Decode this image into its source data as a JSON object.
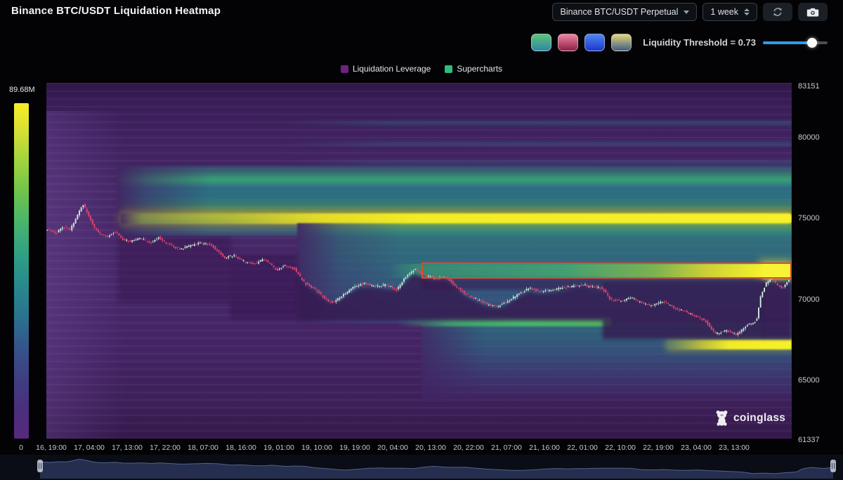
{
  "header": {
    "title": "Binance BTC/USDT Liquidation Heatmap",
    "pair_select": "Binance BTC/USDT Perpetual",
    "interval_select": "1 week"
  },
  "toolbar": {
    "threshold_label": "Liquidity Threshold = 0.73",
    "threshold_value": 0.73,
    "palettes": [
      {
        "name": "green-teal",
        "stops": [
          "#5cc573",
          "#2f86a8"
        ]
      },
      {
        "name": "pink-red",
        "stops": [
          "#ef86a4",
          "#8c1f44"
        ]
      },
      {
        "name": "blue",
        "stops": [
          "#4d86f2",
          "#1c38cc"
        ]
      },
      {
        "name": "yellow-steel",
        "stops": [
          "#e7d878",
          "#3e5c88"
        ]
      }
    ]
  },
  "legend": [
    {
      "label": "Liquidation Leverage",
      "color": "#6a2380"
    },
    {
      "label": "Supercharts",
      "color": "#2ebd7d"
    }
  ],
  "colorbar": {
    "max": "89.68M",
    "min": "0"
  },
  "watermark": "coinglass",
  "colors": {
    "accent_blue": "#2e9bf0",
    "annotation_red": "#e2492b",
    "candle_up": "#cfeede",
    "candle_down": "#e5446e",
    "heat_low": "#46266a",
    "heat_mid": "#21918c",
    "heat_high": "#f6ee21"
  },
  "chart_data": {
    "type": "heatmap",
    "subtype": "liquidation-heatmap-with-candlesticks",
    "y_axis": {
      "min": 61337,
      "max": 83151,
      "ticks": [
        83151,
        80000,
        75000,
        70000,
        65000,
        61337
      ]
    },
    "x_axis": {
      "ticks": [
        "16, 19:00",
        "17, 04:00",
        "17, 13:00",
        "17, 22:00",
        "18, 07:00",
        "18, 16:00",
        "19, 01:00",
        "19, 10:00",
        "19, 19:00",
        "20, 04:00",
        "20, 13:00",
        "20, 22:00",
        "21, 07:00",
        "21, 16:00",
        "22, 01:00",
        "22, 10:00",
        "22, 19:00",
        "23, 04:00",
        "23, 13:00"
      ]
    },
    "colorbar": {
      "max_label": "89.68M",
      "min_label": "0",
      "max_value_usd": 89680000
    },
    "liquidity_levels": [
      {
        "price": 75050,
        "extent": "full width",
        "intensity": 1.0
      },
      {
        "price": 77200,
        "extent": "from 17, 04:00",
        "intensity": 0.6
      },
      {
        "price": 71700,
        "extent": "from 20, 04:00 to end",
        "intensity": 0.9,
        "boxed": true
      },
      {
        "price": 68700,
        "extent": "19, 19:00 to 22, 10:00",
        "intensity": 0.6
      },
      {
        "price": 67300,
        "extent": "from 22, 10:00 to end",
        "intensity": 0.95
      }
    ],
    "annotation_box": {
      "t0": 0.503,
      "t1": 1.0,
      "price_top": 72260,
      "price_bottom": 71320,
      "color": "#e2492b"
    },
    "price_path": {
      "t": [
        0.005,
        0.014,
        0.024,
        0.033,
        0.04,
        0.05,
        0.057,
        0.065,
        0.073,
        0.085,
        0.094,
        0.104,
        0.113,
        0.127,
        0.141,
        0.151,
        0.165,
        0.179,
        0.193,
        0.207,
        0.221,
        0.231,
        0.24,
        0.254,
        0.268,
        0.282,
        0.292,
        0.301,
        0.311,
        0.32,
        0.334,
        0.348,
        0.362,
        0.377,
        0.386,
        0.4,
        0.414,
        0.428,
        0.443,
        0.457,
        0.471,
        0.485,
        0.496,
        0.508,
        0.523,
        0.537,
        0.551,
        0.565,
        0.579,
        0.593,
        0.607,
        0.621,
        0.636,
        0.65,
        0.664,
        0.678,
        0.692,
        0.706,
        0.72,
        0.734,
        0.747,
        0.758,
        0.772,
        0.786,
        0.8,
        0.814,
        0.829,
        0.843,
        0.857,
        0.871,
        0.885,
        0.899,
        0.913,
        0.927,
        0.941,
        0.954,
        0.96,
        0.967,
        0.974,
        0.982,
        0.989,
        0.997
      ],
      "price": [
        74300,
        74100,
        74500,
        74300,
        74900,
        75900,
        75300,
        74500,
        74000,
        73900,
        74200,
        73700,
        73600,
        73800,
        73500,
        73850,
        73400,
        73100,
        73300,
        73500,
        73400,
        73000,
        72600,
        72700,
        72300,
        72200,
        72500,
        72200,
        71800,
        72100,
        71900,
        71000,
        70600,
        70000,
        69800,
        70300,
        70800,
        71000,
        70800,
        70900,
        70600,
        71500,
        71900,
        71500,
        71300,
        71400,
        70800,
        70300,
        70000,
        69700,
        69600,
        69900,
        70400,
        70700,
        70500,
        70600,
        70700,
        70800,
        70900,
        70800,
        70700,
        70000,
        69900,
        70100,
        69800,
        69600,
        69900,
        69500,
        69300,
        69000,
        68700,
        67900,
        68100,
        67800,
        68400,
        68700,
        70300,
        71000,
        71300,
        70900,
        70700,
        71200
      ]
    },
    "candle_count": 395
  }
}
